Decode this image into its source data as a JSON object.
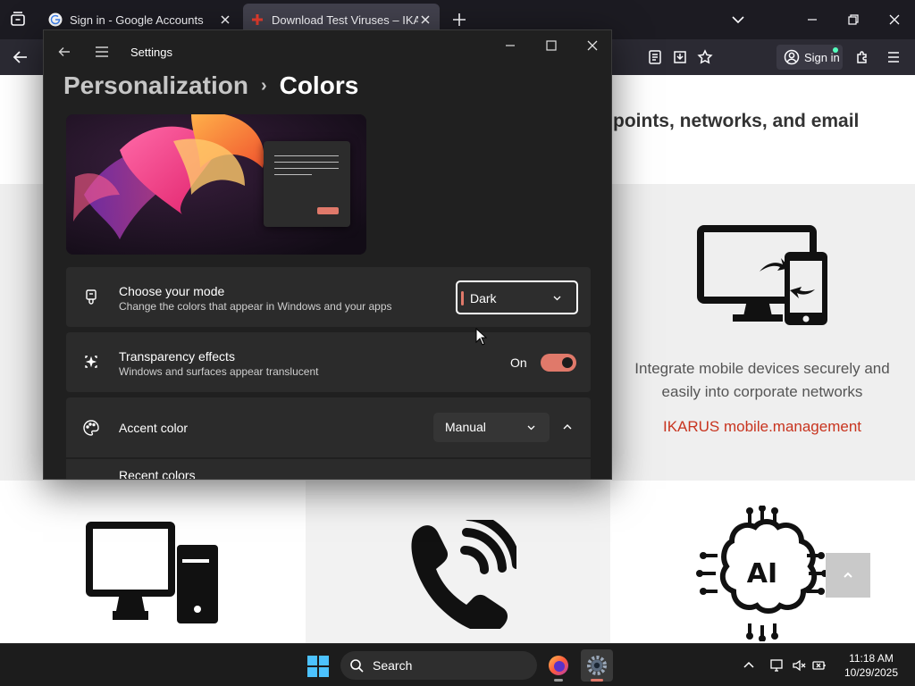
{
  "browser": {
    "tabs": [
      {
        "title": "Sign in - Google Accounts",
        "favicon": "google-icon",
        "active": false
      },
      {
        "title": "Download Test Viruses – IKARUS",
        "favicon": "ikarus-icon",
        "active": true
      }
    ],
    "signin_label": "Sign in"
  },
  "webpage": {
    "heading_fragment": "points, networks, and email",
    "feature_text": "Integrate mobile devices securely and easily into corporate networks",
    "feature_link": "IKARUS mobile.management",
    "icons": [
      "devices-sync-icon",
      "desktop-computer-icon",
      "phone-call-icon",
      "ai-brain-icon"
    ],
    "scroll_top_icon": "chevron-up-icon"
  },
  "settings": {
    "window_title": "Settings",
    "breadcrumb": {
      "parent": "Personalization",
      "separator": "›",
      "current": "Colors"
    },
    "mode": {
      "label": "Choose your mode",
      "description": "Change the colors that appear in Windows and your apps",
      "value": "Dark"
    },
    "transparency": {
      "label": "Transparency effects",
      "description": "Windows and surfaces appear translucent",
      "state_label": "On",
      "enabled": true
    },
    "accent": {
      "label": "Accent color",
      "value": "Manual"
    },
    "recent_colors_label": "Recent colors",
    "accent_color": "#e0796a"
  },
  "taskbar": {
    "search_placeholder": "Search",
    "apps": [
      "firefox-icon",
      "settings-gear-icon"
    ],
    "time": "11:18 AM",
    "date": "10/29/2025"
  }
}
